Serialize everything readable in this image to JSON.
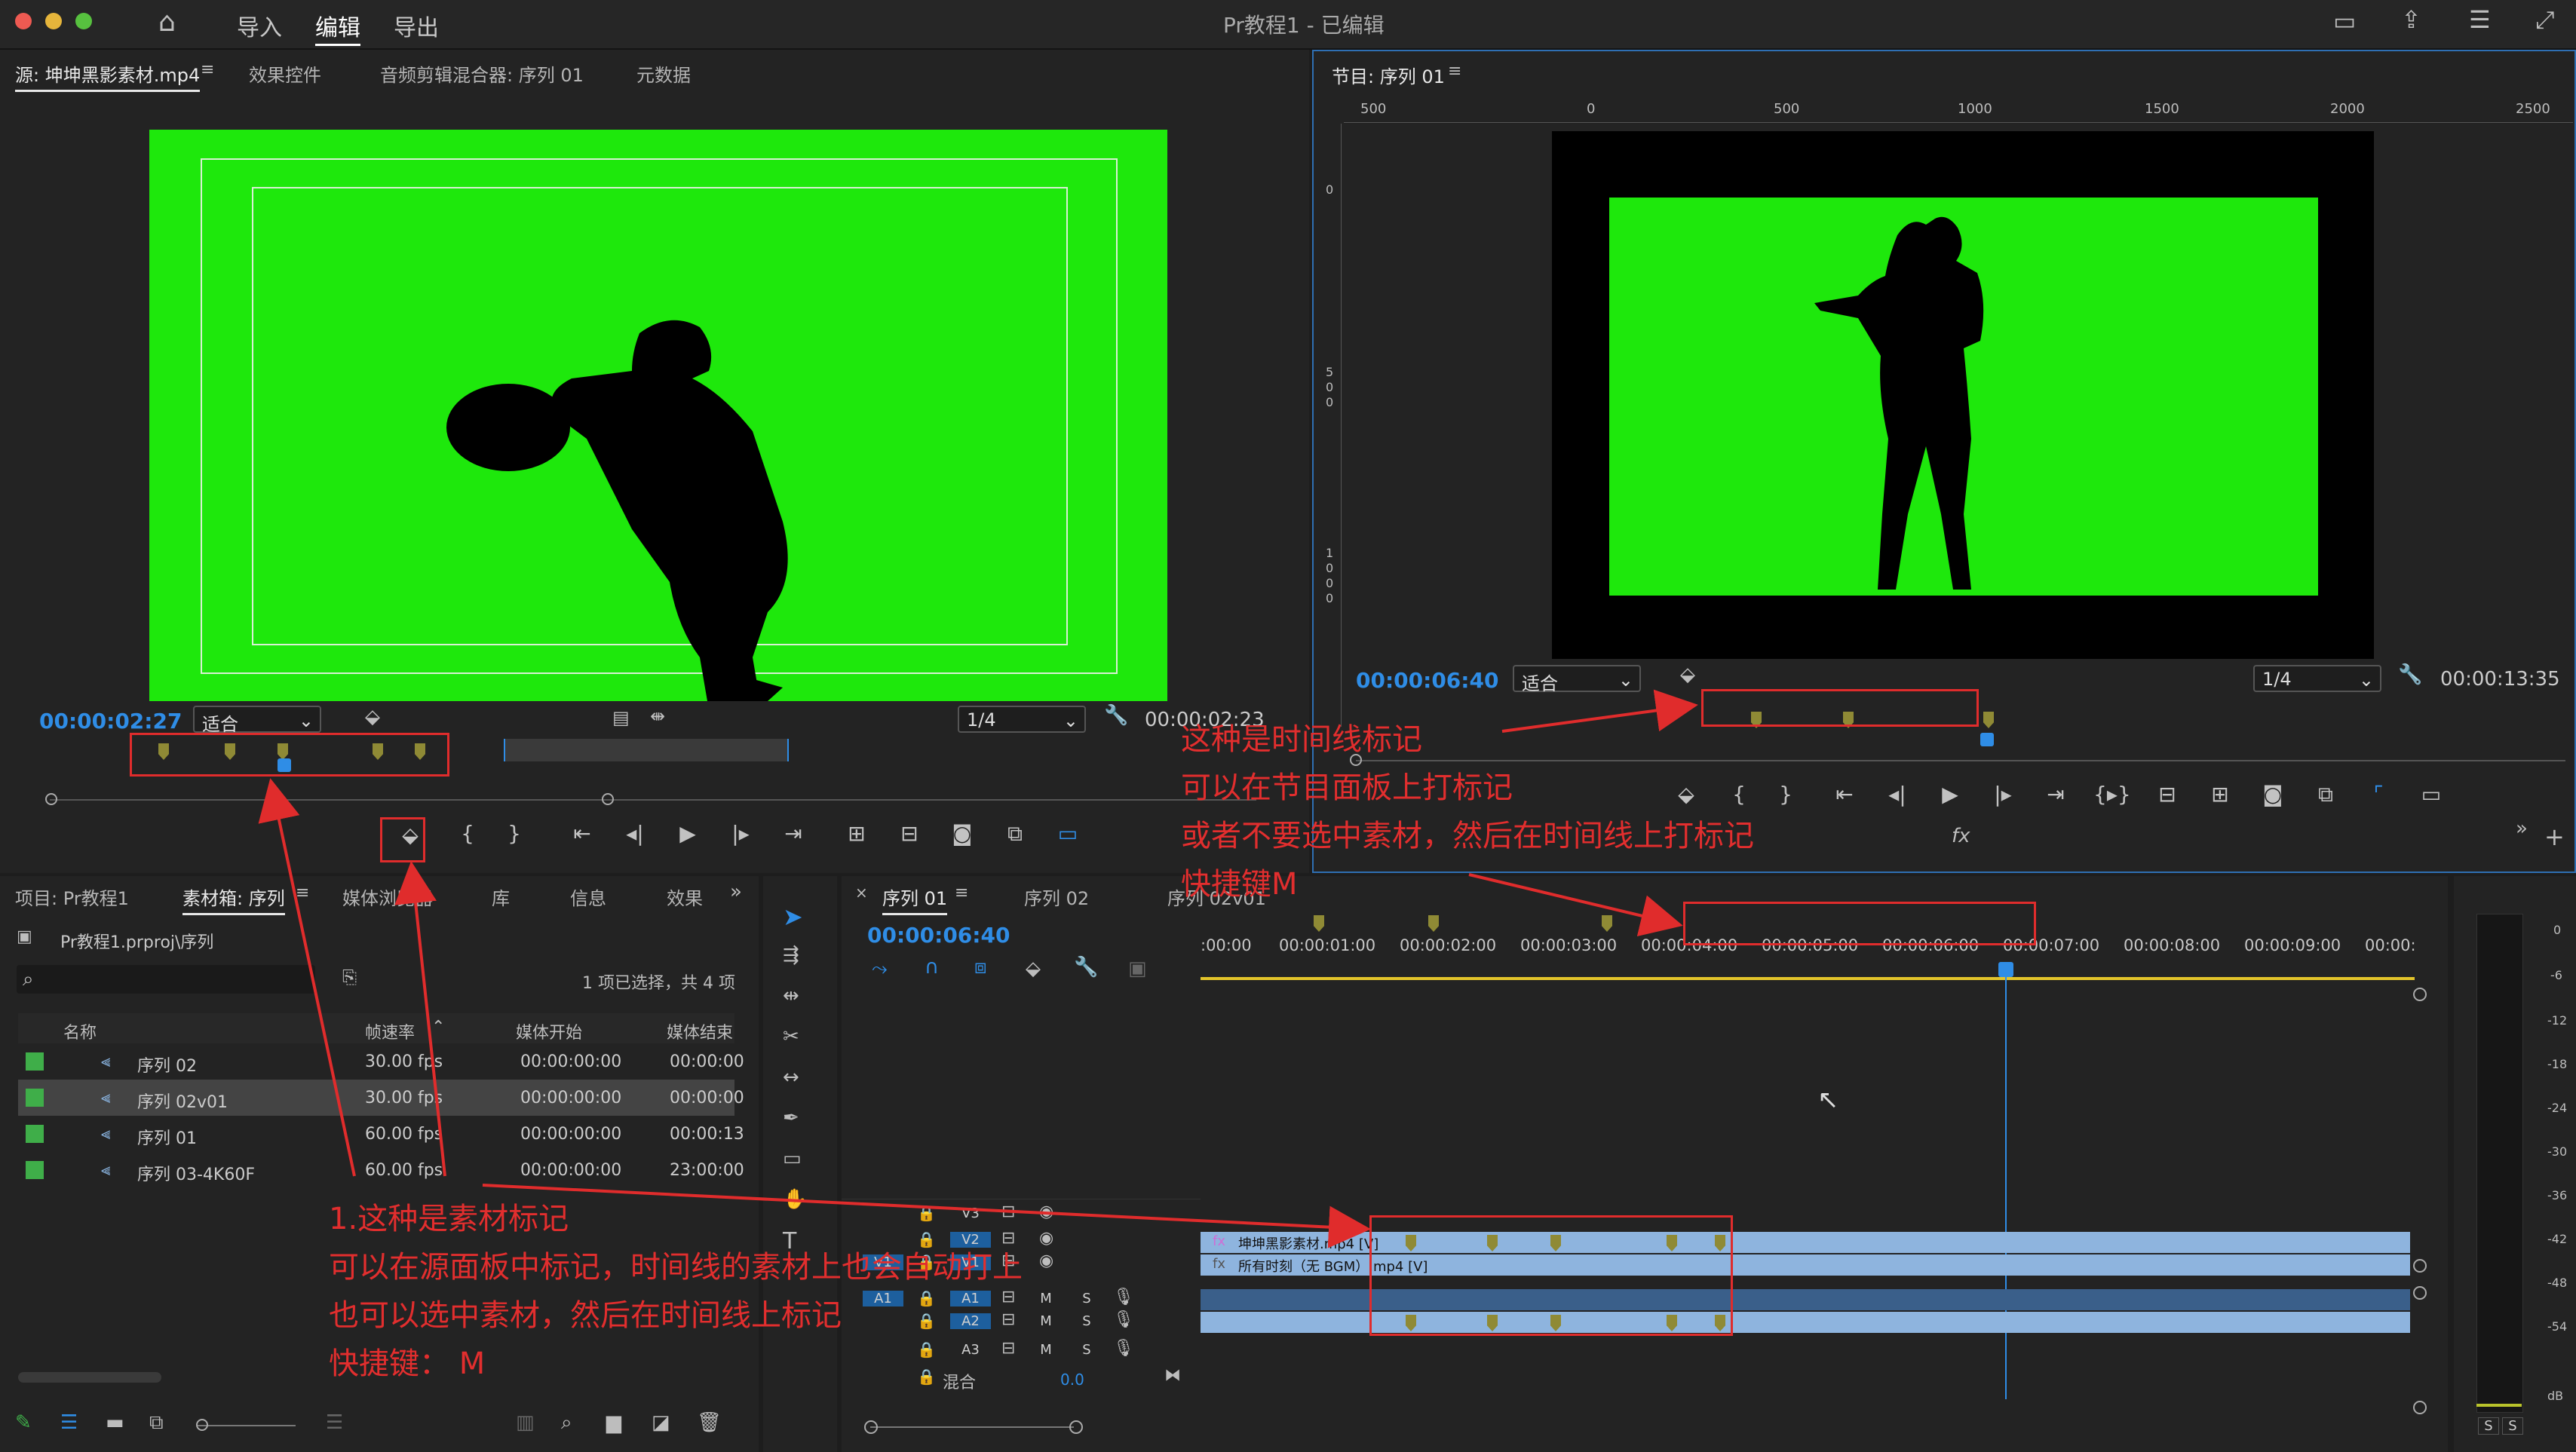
{
  "app": {
    "title": "Pr教程1 - 已编辑",
    "workspaces": {
      "import": "导入",
      "edit": "编辑",
      "export": "导出"
    }
  },
  "source_panel": {
    "tabs": [
      "源: 坤坤黑影素材.mp4",
      "效果控件",
      "音频剪辑混合器: 序列 01",
      "元数据"
    ],
    "timecode_current": "00:00:02:27",
    "zoom": "适合",
    "resolution": "1/4",
    "timecode_duration": "00:00:02:23"
  },
  "program_panel": {
    "tab": "节目: 序列 01",
    "ruler_top": [
      "500",
      "0",
      "500",
      "1000",
      "1500",
      "2000",
      "2500"
    ],
    "ruler_left": [
      "0",
      "5\n0\n0",
      "1\n0\n0\n0"
    ],
    "timecode_current": "00:00:06:40",
    "zoom": "适合",
    "resolution": "1/4",
    "timecode_duration": "00:00:13:35"
  },
  "project_panel": {
    "tabs": [
      "项目: Pr教程1",
      "素材箱: 序列",
      "媒体浏览器",
      "库",
      "信息",
      "效果"
    ],
    "path": "Pr教程1.prproj\\序列",
    "selection_status": "1 项已选择，共 4 项",
    "columns": [
      "名称",
      "帧速率",
      "媒体开始",
      "媒体结束"
    ],
    "rows": [
      {
        "name": "序列 02",
        "fps": "30.00 fps",
        "start": "00:00:00:00",
        "end": "00:00:00"
      },
      {
        "name": "序列 02v01",
        "fps": "30.00 fps",
        "start": "00:00:00:00",
        "end": "00:00:00"
      },
      {
        "name": "序列 01",
        "fps": "60.00 fps",
        "start": "00:00:00:00",
        "end": "00:00:13"
      },
      {
        "name": "序列 03-4K60F",
        "fps": "60.00 fps",
        "start": "00:00:00:00",
        "end": "23:00:00"
      }
    ]
  },
  "timeline": {
    "tabs": [
      "序列 01",
      "序列 02",
      "序列 02v01"
    ],
    "timecode": "00:00:06:40",
    "ruler": [
      ":00:00",
      "00:00:01:00",
      "00:00:02:00",
      "00:00:03:00",
      "00:00:04:00",
      "00:00:05:00",
      "00:00:06:00",
      "00:00:07:00",
      "00:00:08:00",
      "00:00:09:00",
      "00:00:"
    ],
    "tracks": {
      "v3": "V3",
      "v2": "V2",
      "v1_src": "V1",
      "v1": "V1",
      "a1_src": "A1",
      "a1": "A1",
      "a2": "A2",
      "a3": "A3",
      "m": "M",
      "s": "S",
      "mix": "混合",
      "mix_value": "0.0"
    },
    "clip_v2": "坤坤黑影素材.mp4 [V]",
    "clip_v1": "所有时刻（无 BGM）.mp4 [V]"
  },
  "meter": {
    "scale": [
      "0",
      "-6",
      "-12",
      "-18",
      "-24",
      "-30",
      "-36",
      "-42",
      "-48",
      "-54",
      "dB"
    ],
    "solo": [
      "S",
      "S"
    ]
  },
  "annotations": {
    "timeline_marker": [
      "这种是时间线标记",
      "可以在节目面板上打标记",
      "或者不要选中素材，然后在时间线上打标记",
      "快捷键M"
    ],
    "clip_marker": [
      "1.这种是素材标记",
      "可以在源面板中标记，时间线的素材上也会自动打上",
      "也可以选中素材，然后在时间线上标记",
      "快捷键：  M"
    ]
  },
  "colors": {
    "green_screen": "#1ee80c",
    "accent_blue": "#2f8de6",
    "annotation_red": "#e02c2c",
    "marker": "#8f8a35",
    "clip_blue": "#8eb4de"
  }
}
